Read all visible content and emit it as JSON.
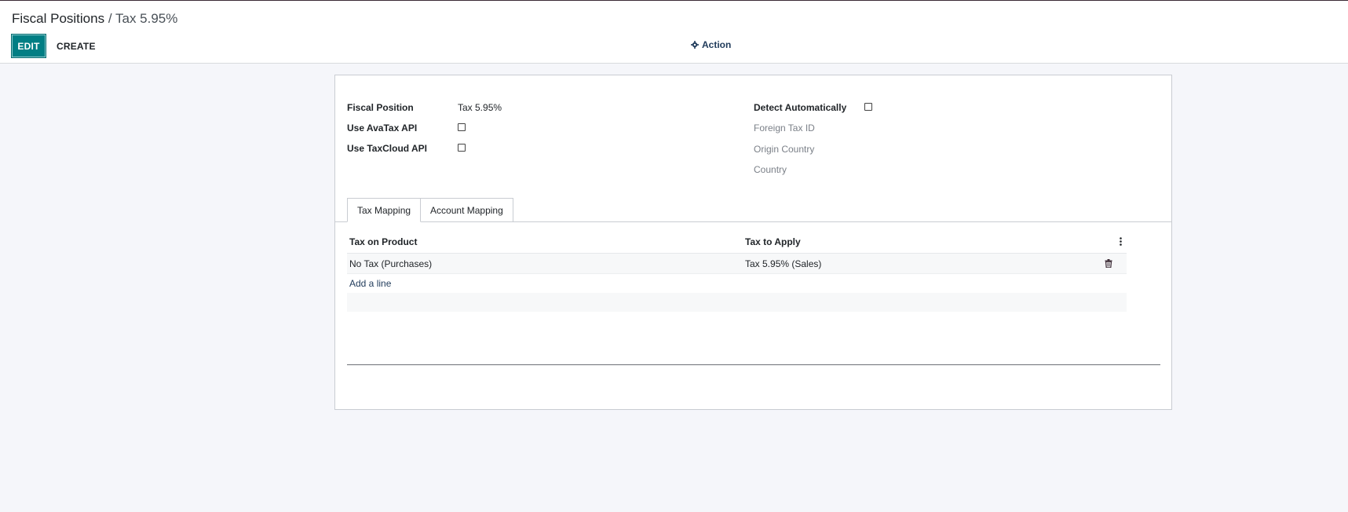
{
  "breadcrumb": {
    "parent": "Fiscal Positions",
    "separator": " / ",
    "current": "Tax 5.95%"
  },
  "toolbar": {
    "edit_label": "EDIT",
    "create_label": "CREATE",
    "action_label": "Action"
  },
  "form": {
    "fiscal_position_label": "Fiscal Position",
    "fiscal_position_value": "Tax 5.95%",
    "use_avatax_label": "Use AvaTax API",
    "use_taxcloud_label": "Use TaxCloud API",
    "detect_auto_label": "Detect Automatically",
    "foreign_tax_id_label": "Foreign Tax ID",
    "origin_country_label": "Origin Country",
    "country_label": "Country"
  },
  "tabs": [
    {
      "label": "Tax Mapping",
      "active": true
    },
    {
      "label": "Account Mapping",
      "active": false
    }
  ],
  "grid": {
    "columns": [
      "Tax on Product",
      "Tax to Apply"
    ],
    "rows": [
      {
        "tax_on_product": "No Tax (Purchases)",
        "tax_to_apply": "Tax 5.95% (Sales)"
      }
    ],
    "add_line_label": "Add a line"
  },
  "colors": {
    "primary": "#017e84",
    "background": "#f5f6fa"
  }
}
